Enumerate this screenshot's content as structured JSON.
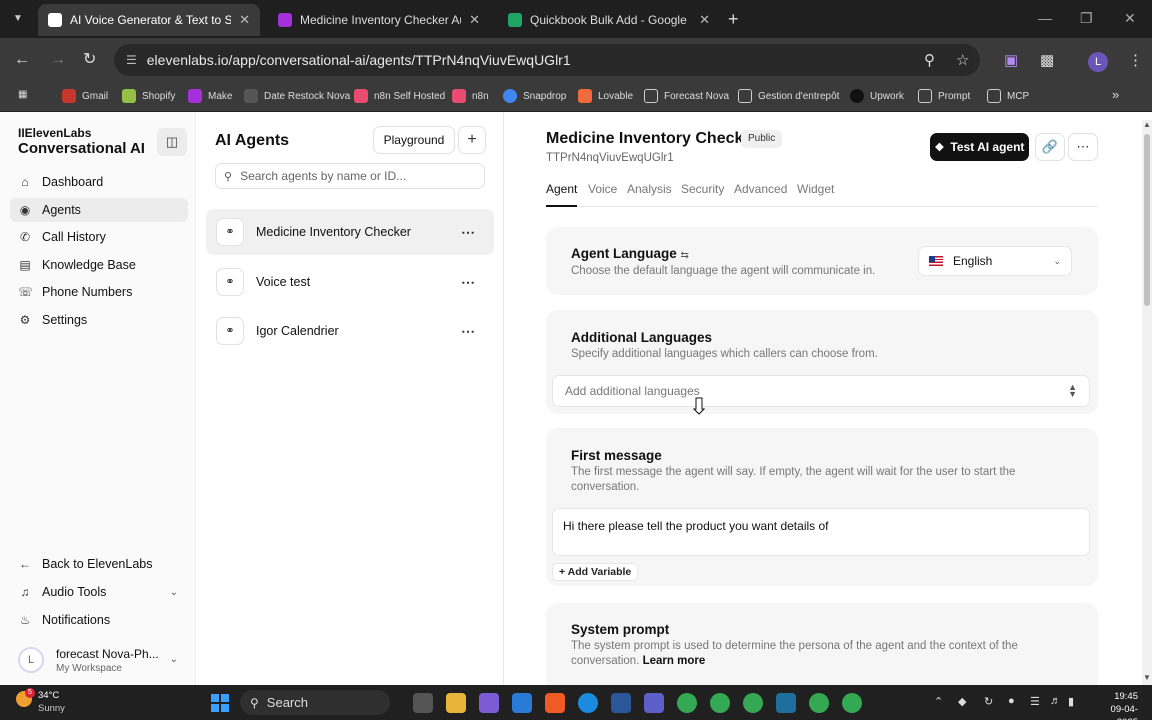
{
  "browser": {
    "tabs": [
      {
        "title": "AI Voice Generator & Text to Speech | Elev",
        "active": true
      },
      {
        "title": "Medicine Inventory Checker Automation",
        "active": false
      },
      {
        "title": "Quickbook Bulk Add - Google Feuilles de",
        "active": false
      }
    ],
    "url": "elevenlabs.io/app/conversational-ai/agents/TTPrN4nqViuvEwqUGlr1",
    "profile_initial": "L",
    "bookmarks": [
      "Gmail",
      "Shopify",
      "Make",
      "Date Restock Nova",
      "n8n Self Hosted",
      "n8n",
      "Snapdrop",
      "Lovable",
      "Forecast Nova",
      "Gestion d'entrepôt",
      "Upwork",
      "Prompt",
      "MCP"
    ]
  },
  "sidebar": {
    "logo_small": "IIElevenLabs",
    "logo_big": "Conversational AI",
    "items": [
      {
        "label": "Dashboard",
        "icon": "home-icon"
      },
      {
        "label": "Agents",
        "icon": "agents-icon"
      },
      {
        "label": "Call History",
        "icon": "phone-history-icon"
      },
      {
        "label": "Knowledge Base",
        "icon": "book-icon"
      },
      {
        "label": "Phone Numbers",
        "icon": "phone-icon"
      },
      {
        "label": "Settings",
        "icon": "gear-icon"
      }
    ],
    "bottom_items": [
      {
        "label": "Back to ElevenLabs",
        "icon": "back-icon"
      },
      {
        "label": "Audio Tools",
        "icon": "audio-icon"
      },
      {
        "label": "Notifications",
        "icon": "bell-icon"
      }
    ],
    "account": {
      "name": "forecast Nova-Ph...",
      "workspace": "My Workspace",
      "initial": "L"
    }
  },
  "agents_panel": {
    "title": "AI Agents",
    "playground_label": "Playground",
    "search_placeholder": "Search agents by name or ID...",
    "agents": [
      {
        "name": "Medicine Inventory Checker",
        "active": true
      },
      {
        "name": "Voice test",
        "active": false
      },
      {
        "name": "Igor Calendrier",
        "active": false
      }
    ]
  },
  "agent": {
    "name": "Medicine Inventory Checker",
    "visibility": "Public",
    "id": "TTPrN4nqViuvEwqUGlr1",
    "test_label": "Test AI agent",
    "tabs": [
      "Agent",
      "Voice",
      "Analysis",
      "Security",
      "Advanced",
      "Widget"
    ],
    "active_tab": "Agent",
    "language": {
      "title": "Agent Language",
      "desc": "Choose the default language the agent will communicate in.",
      "value": "English"
    },
    "additional_languages": {
      "title": "Additional Languages",
      "desc": "Specify additional languages which callers can choose from.",
      "placeholder": "Add additional languages"
    },
    "first_message": {
      "title": "First message",
      "desc": "The first message the agent will say. If empty, the agent will wait for the user to start the conversation.",
      "value": "Hi there please tell the product you want details of",
      "add_variable": "Add Variable"
    },
    "system_prompt": {
      "title": "System prompt",
      "desc": "The system prompt is used to determine the persona of the agent and the context of the conversation.",
      "learn_more": "Learn more"
    }
  },
  "taskbar": {
    "temperature": "34°C",
    "weather": "Sunny",
    "weather_badge": "5",
    "search_label": "Search",
    "time": "19:45",
    "date": "09-04-2025"
  }
}
